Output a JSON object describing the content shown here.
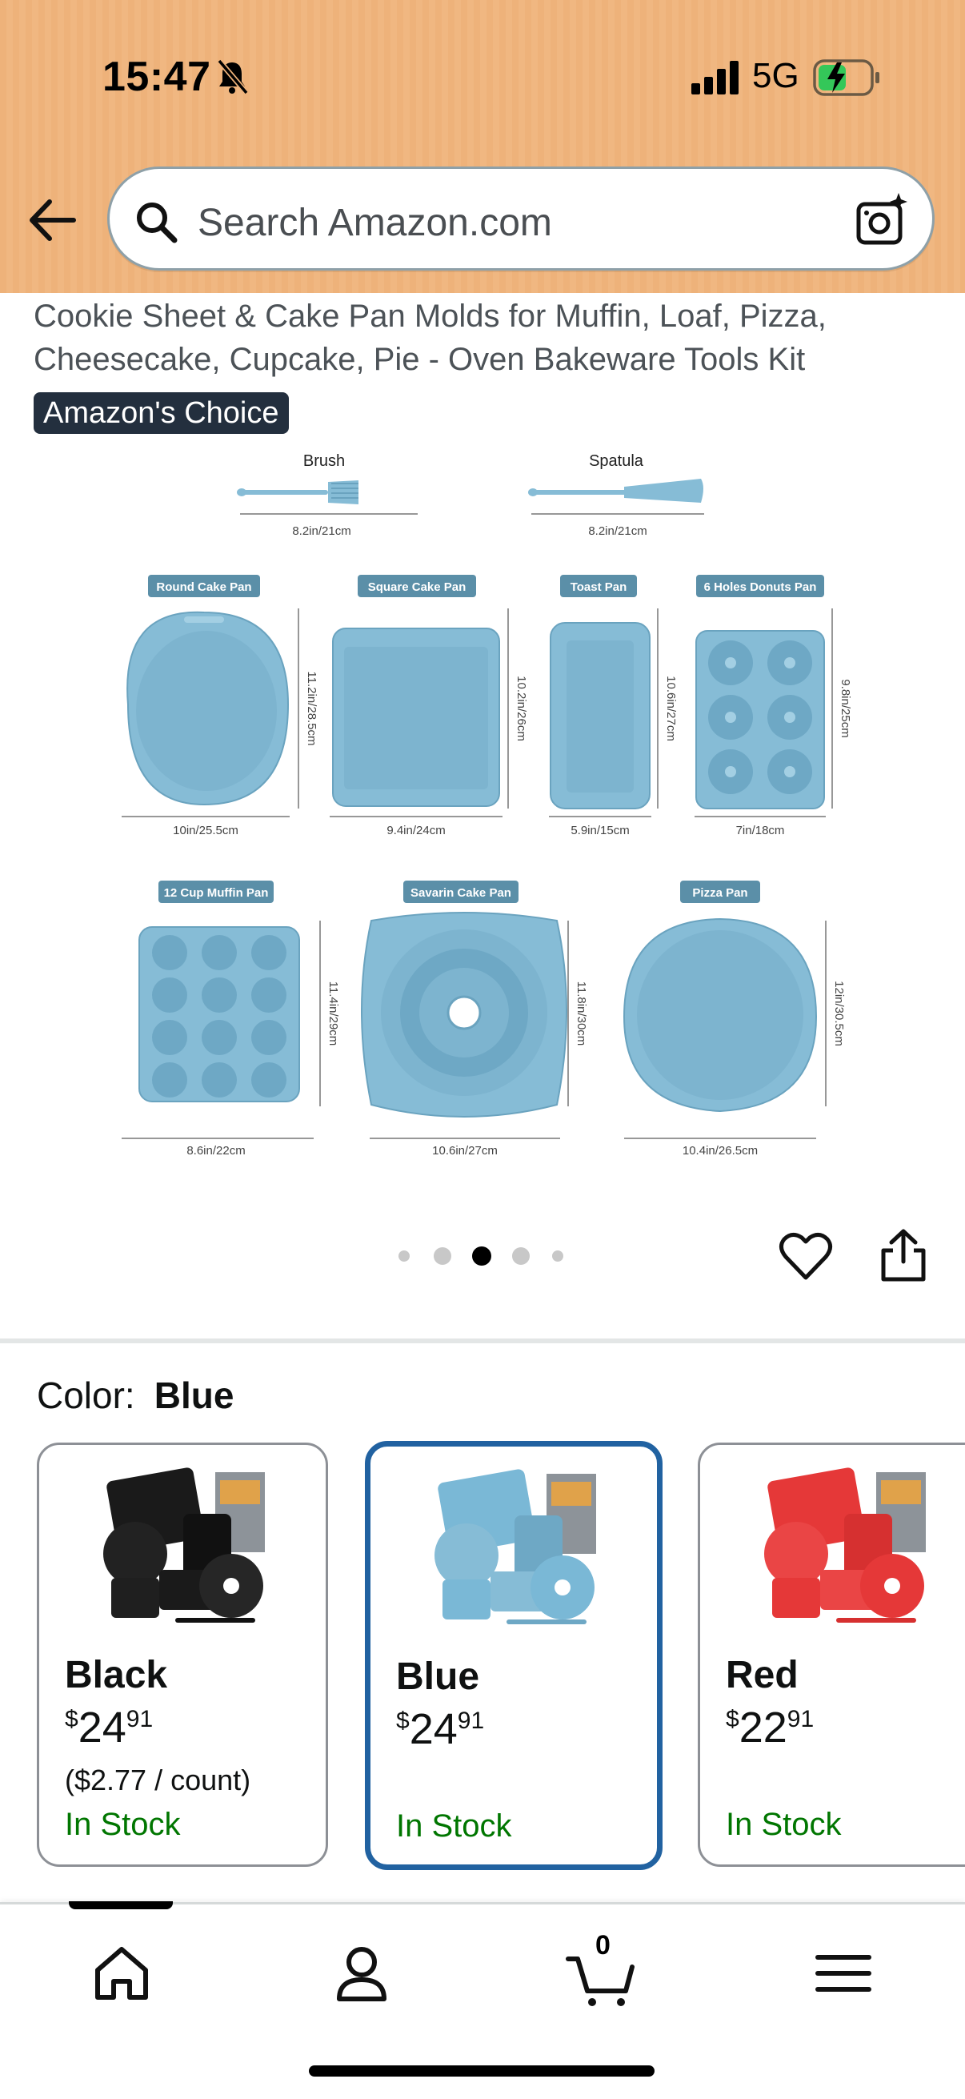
{
  "status_bar": {
    "time": "15:47",
    "network": "5G",
    "battery_charging": true
  },
  "search": {
    "placeholder": "Search Amazon.com"
  },
  "product": {
    "title": "Cookie Sheet & Cake Pan Molds for Muffin, Loaf, Pizza, Cheesecake, Cupcake, Pie - Oven Bakeware Tools Kit",
    "badge": "Amazon's Choice",
    "image": {
      "tools": [
        {
          "label": "Brush",
          "dimension": "8.2in/21cm"
        },
        {
          "label": "Spatula",
          "dimension": "8.2in/21cm"
        }
      ],
      "pans_row1": [
        {
          "label": "Round Cake Pan",
          "width": "10in/25.5cm",
          "height": "11.2in/28.5cm"
        },
        {
          "label": "Square Cake Pan",
          "width": "9.4in/24cm",
          "height": "10.2in/26cm"
        },
        {
          "label": "Toast Pan",
          "width": "5.9in/15cm",
          "height": "10.6in/27cm"
        },
        {
          "label": "6 Holes Donuts Pan",
          "width": "7in/18cm",
          "height": "9.8in/25cm"
        }
      ],
      "pans_row2": [
        {
          "label": "12 Cup Muffin Pan",
          "width": "8.6in/22cm",
          "height": "11.4in/29cm"
        },
        {
          "label": "Savarin Cake Pan",
          "width": "10.6in/27cm",
          "height": "11.8in/30cm"
        },
        {
          "label": "Pizza Pan",
          "width": "10.4in/26.5cm",
          "height": "12in/30.5cm"
        }
      ]
    },
    "image_dots": {
      "count": 5,
      "active_index": 2
    }
  },
  "color": {
    "label": "Color:",
    "selected": "Blue",
    "options": [
      {
        "name": "Black",
        "price_whole": "24",
        "price_fraction": "91",
        "currency": "$",
        "unit_price": "($2.77 / count)",
        "stock": "In Stock",
        "color": "#1a1a1a"
      },
      {
        "name": "Blue",
        "price_whole": "24",
        "price_fraction": "91",
        "currency": "$",
        "unit_price": "",
        "stock": "In Stock",
        "color": "#7ab8d6"
      },
      {
        "name": "Red",
        "price_whole": "22",
        "price_fraction": "91",
        "currency": "$",
        "unit_price": "",
        "stock": "In Stock",
        "color": "#e53838"
      }
    ]
  },
  "nav": {
    "cart_count": "0"
  },
  "colors": {
    "header_bg": "#eeb27a",
    "badge_bg": "#232f3e",
    "selected_border": "#2162a1",
    "in_stock": "#007600",
    "pan_blue": "#86bcd6",
    "label_bg": "#5b8fa8"
  }
}
